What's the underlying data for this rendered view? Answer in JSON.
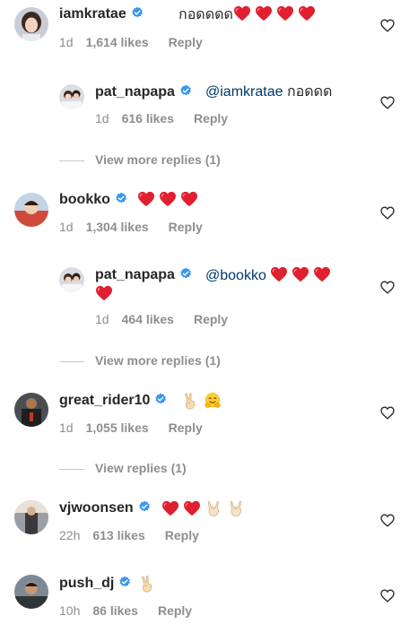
{
  "comments": [
    {
      "username": "iamkratae",
      "text": "กอดดดด",
      "time": "1d",
      "likes": "1,614 likes",
      "reply": "Reply"
    },
    {
      "username": "pat_napapa",
      "mention": "@iamkratae",
      "text": "กอดดด",
      "time": "1d",
      "likes": "616 likes",
      "reply": "Reply"
    },
    {
      "username": "bookko",
      "time": "1d",
      "likes": "1,304 likes",
      "reply": "Reply"
    },
    {
      "username": "pat_napapa",
      "mention": "@bookko",
      "time": "1d",
      "likes": "464 likes",
      "reply": "Reply"
    },
    {
      "username": "great_rider10",
      "time": "1d",
      "likes": "1,055 likes",
      "reply": "Reply"
    },
    {
      "username": "vjwoonsen",
      "time": "22h",
      "likes": "613 likes",
      "reply": "Reply"
    },
    {
      "username": "push_dj",
      "time": "10h",
      "likes": "86 likes",
      "reply": "Reply"
    }
  ],
  "view_more": [
    "View more replies (1)",
    "View more replies (1)",
    "View replies (1)"
  ],
  "colors": {
    "text": "#262626",
    "secondary": "#8e8e8e",
    "mention": "#00376b",
    "verified": "#3897f0",
    "heart": "#ed4956"
  },
  "icons": [
    "verified-badge-icon",
    "red-heart-emoji",
    "victory-hand-emoji",
    "hugging-face-emoji",
    "rock-on-hand-emoji",
    "like-heart-icon"
  ]
}
